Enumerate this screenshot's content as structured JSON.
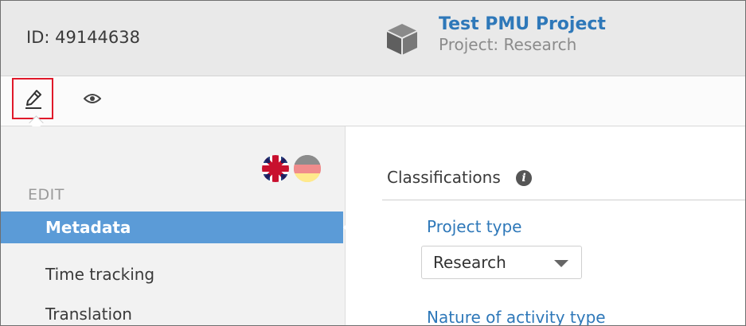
{
  "header": {
    "id_text": "ID: 49144638",
    "project_title": "Test PMU Project",
    "project_subtitle": "Project: Research"
  },
  "toolbar": {
    "edit_icon": "pencil-icon",
    "view_icon": "eye-icon"
  },
  "sidebar": {
    "languages": [
      "uk-flag-icon",
      "germany-flag-icon"
    ],
    "section_label": "EDIT",
    "items": [
      {
        "label": "Metadata",
        "active": true
      },
      {
        "label": "Time tracking",
        "active": false
      },
      {
        "label": "Translation",
        "active": false
      }
    ]
  },
  "main": {
    "section_title": "Classifications",
    "info_glyph": "i",
    "fields": [
      {
        "label": "Project type",
        "value": "Research"
      },
      {
        "label": "Nature of activity type"
      }
    ]
  },
  "colors": {
    "accent_blue": "#2e78b9",
    "active_nav": "#5b9bd7",
    "highlight_red": "#e0192a"
  }
}
